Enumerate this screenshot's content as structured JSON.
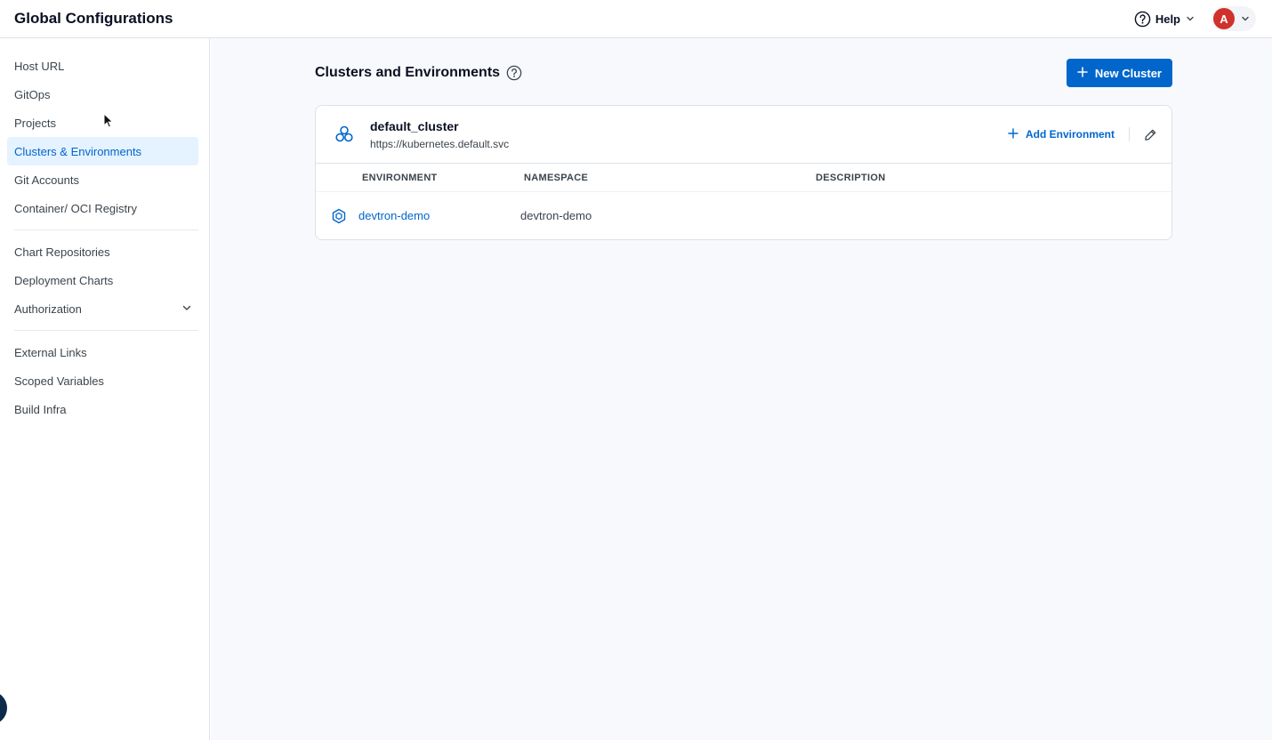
{
  "header": {
    "title": "Global Configurations",
    "help_label": "Help",
    "user_initial": "A"
  },
  "sidebar": {
    "groups": [
      [
        {
          "label": "Host URL"
        },
        {
          "label": "GitOps"
        },
        {
          "label": "Projects"
        },
        {
          "label": "Clusters & Environments",
          "active": true
        },
        {
          "label": "Git Accounts"
        },
        {
          "label": "Container/ OCI Registry"
        }
      ],
      [
        {
          "label": "Chart Repositories"
        },
        {
          "label": "Deployment Charts"
        },
        {
          "label": "Authorization",
          "expandable": true
        }
      ],
      [
        {
          "label": "External Links"
        },
        {
          "label": "Scoped Variables"
        },
        {
          "label": "Build Infra"
        }
      ]
    ]
  },
  "main": {
    "title": "Clusters and Environments",
    "new_cluster_label": "New Cluster",
    "cluster": {
      "name": "default_cluster",
      "url": "https://kubernetes.default.svc",
      "add_environment_label": "Add Environment",
      "columns": [
        "ENVIRONMENT",
        "NAMESPACE",
        "DESCRIPTION"
      ],
      "environments": [
        {
          "name": "devtron-demo",
          "namespace": "devtron-demo",
          "description": ""
        }
      ]
    }
  },
  "colors": {
    "accent": "#0066cc",
    "active_bg": "#e5f2ff",
    "avatar": "#d0312d",
    "main_bg": "#f8f9fc"
  }
}
